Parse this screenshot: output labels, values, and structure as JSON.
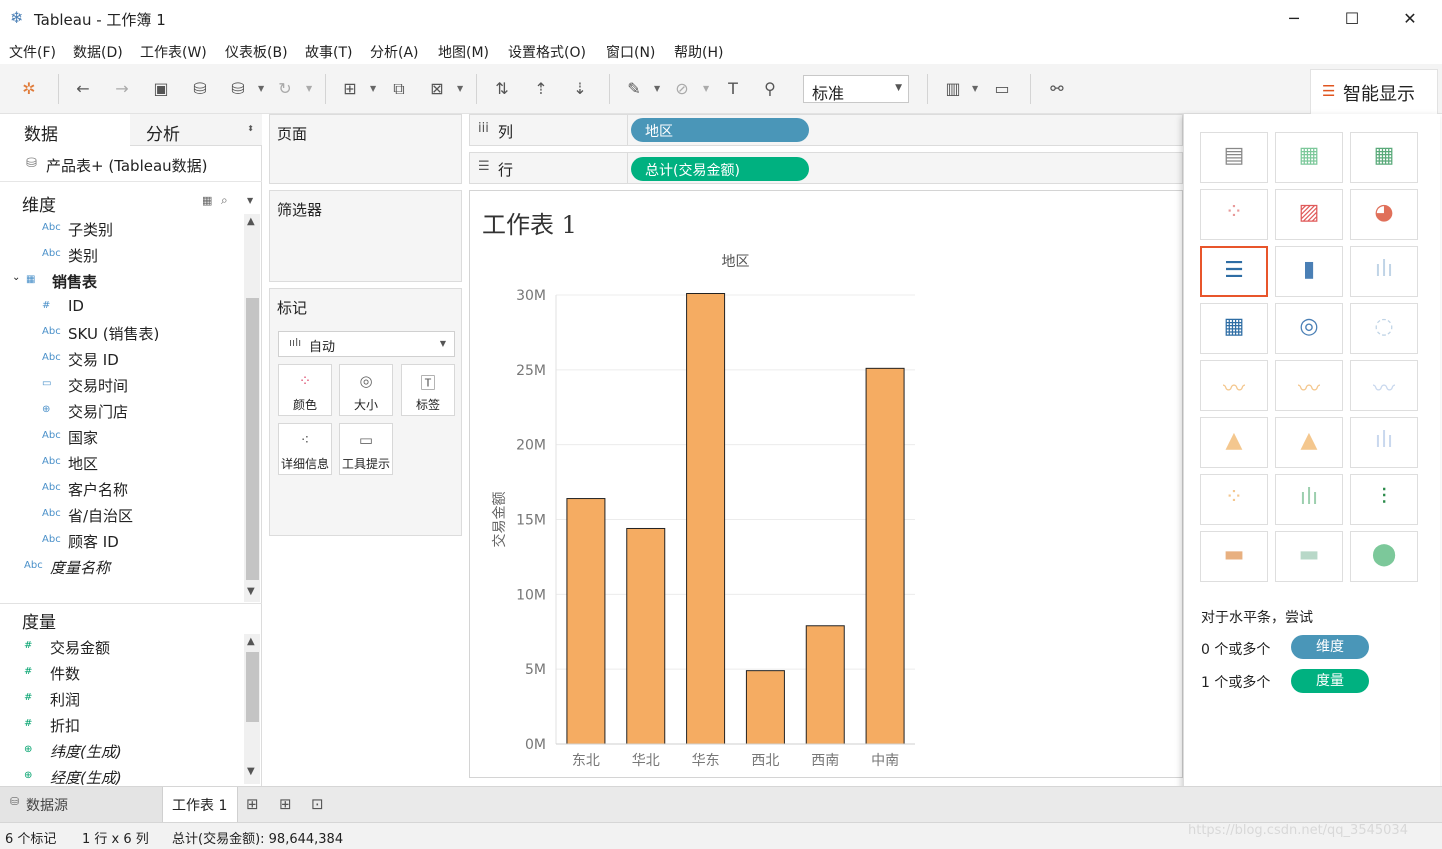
{
  "window": {
    "title": "Tableau - 工作簿 1",
    "minimize": "─",
    "maximize": "☐",
    "close": "✕"
  },
  "menu": [
    "文件(F)",
    "数据(D)",
    "工作表(W)",
    "仪表板(B)",
    "故事(T)",
    "分析(A)",
    "地图(M)",
    "设置格式(O)",
    "窗口(N)",
    "帮助(H)"
  ],
  "toolbar": {
    "fit_select": "标准",
    "show_me_label": "智能显示"
  },
  "left_pane": {
    "tab_data": "数据",
    "tab_analysis": "分析",
    "datasource": "产品表+ (Tableau数据)",
    "dimensions_title": "维度",
    "dimensions": [
      {
        "type": "Abc",
        "name": "子类别"
      },
      {
        "type": "Abc",
        "name": "类别"
      },
      {
        "type": "table",
        "name": "销售表"
      },
      {
        "type": "#",
        "name": "ID"
      },
      {
        "type": "Abc",
        "name": "SKU (销售表)"
      },
      {
        "type": "Abc",
        "name": "交易 ID"
      },
      {
        "type": "date",
        "name": "交易时间"
      },
      {
        "type": "geo",
        "name": "交易门店"
      },
      {
        "type": "Abc",
        "name": "国家"
      },
      {
        "type": "Abc",
        "name": "地区"
      },
      {
        "type": "Abc",
        "name": "客户名称"
      },
      {
        "type": "Abc",
        "name": "省/自治区"
      },
      {
        "type": "Abc",
        "name": "顾客 ID"
      },
      {
        "type": "Abc",
        "name": "度量名称"
      }
    ],
    "measures_title": "度量",
    "measures": [
      {
        "type": "#",
        "name": "交易金额"
      },
      {
        "type": "#",
        "name": "件数"
      },
      {
        "type": "#",
        "name": "利润"
      },
      {
        "type": "#",
        "name": "折扣"
      },
      {
        "type": "geo",
        "name": "纬度(生成)"
      },
      {
        "type": "geo",
        "name": "经度(生成)"
      }
    ]
  },
  "cards": {
    "pages_title": "页面",
    "filters_title": "筛选器",
    "marks_title": "标记",
    "marks_type": "自动",
    "mark_buttons": [
      "颜色",
      "大小",
      "标签",
      "详细信息",
      "工具提示"
    ]
  },
  "shelves": {
    "columns_label": "列",
    "columns_pill": "地区",
    "rows_label": "行",
    "rows_pill": "总计(交易金额)"
  },
  "view": {
    "sheet_title": "工作表 1",
    "header": "地区"
  },
  "chart_data": {
    "type": "bar",
    "title": "工作表 1",
    "xlabel": "地区",
    "ylabel": "交易金额",
    "categories": [
      "东北",
      "华北",
      "华东",
      "西北",
      "西南",
      "中南"
    ],
    "values": [
      16.4,
      14.4,
      30.1,
      4.9,
      7.9,
      25.1
    ],
    "unit": "M",
    "ylim": [
      0,
      30
    ],
    "yticks": [
      "0M",
      "5M",
      "10M",
      "15M",
      "20M",
      "25M",
      "30M"
    ],
    "bar_color": "#f5ac62",
    "grid": true
  },
  "show_me": {
    "hint": "对于水平条，尝试",
    "line1_prefix": "0 个或多个",
    "line1_pill": "维度",
    "line2_prefix": "1 个或多个",
    "line2_pill": "度量",
    "dim_color": "#4a96b8",
    "measure_color": "#00b180"
  },
  "bottom_tabs": {
    "datasource": "数据源",
    "sheet": "工作表 1"
  },
  "status": {
    "marks": "6 个标记",
    "grid": "1 行 x 6 列",
    "sum": "总计(交易金额): 98,644,384"
  },
  "watermark": "https://blog.csdn.net/qq_3545034"
}
